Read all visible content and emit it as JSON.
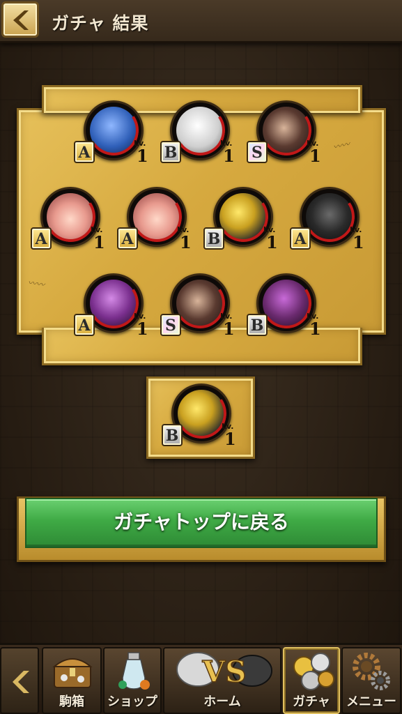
{
  "header": {
    "title": "ガチャ 結果"
  },
  "results": {
    "row1": [
      {
        "rank": "A",
        "lv_label": "Lv.",
        "lv": "1",
        "color": "#2f5fb8"
      },
      {
        "rank": "B",
        "lv_label": "Lv.",
        "lv": "1",
        "color": "#d9d9d9"
      },
      {
        "rank": "S",
        "lv_label": "Lv.",
        "lv": "1",
        "color": "#3a2a2a"
      }
    ],
    "row2": [
      {
        "rank": "A",
        "lv_label": "Lv.",
        "lv": "1",
        "color": "#e89a8e"
      },
      {
        "rank": "A",
        "lv_label": "Lv.",
        "lv": "1",
        "color": "#e89a8e"
      },
      {
        "rank": "B",
        "lv_label": "Lv.",
        "lv": "1",
        "color": "#c9a020"
      },
      {
        "rank": "A",
        "lv_label": "Lv.",
        "lv": "1",
        "color": "#2a2a2a"
      }
    ],
    "row3": [
      {
        "rank": "A",
        "lv_label": "Lv.",
        "lv": "1",
        "color": "#7a2f8e"
      },
      {
        "rank": "S",
        "lv_label": "Lv.",
        "lv": "1",
        "color": "#3a2a2a"
      },
      {
        "rank": "B",
        "lv_label": "Lv.",
        "lv": "1",
        "color": "#6a2a6e"
      }
    ],
    "bonus": {
      "rank": "B",
      "lv_label": "Lv.",
      "lv": "1",
      "color": "#c9a020"
    }
  },
  "return_button": {
    "label": "ガチャトップに戻る"
  },
  "nav": {
    "items": [
      {
        "label": "駒箱",
        "icon": "chest-icon"
      },
      {
        "label": "ショップ",
        "icon": "potion-icon"
      },
      {
        "label": "ホーム",
        "icon": "vs-icon"
      },
      {
        "label": "ガチャ",
        "icon": "coins-icon"
      },
      {
        "label": "メニュー",
        "icon": "gears-icon"
      }
    ]
  }
}
